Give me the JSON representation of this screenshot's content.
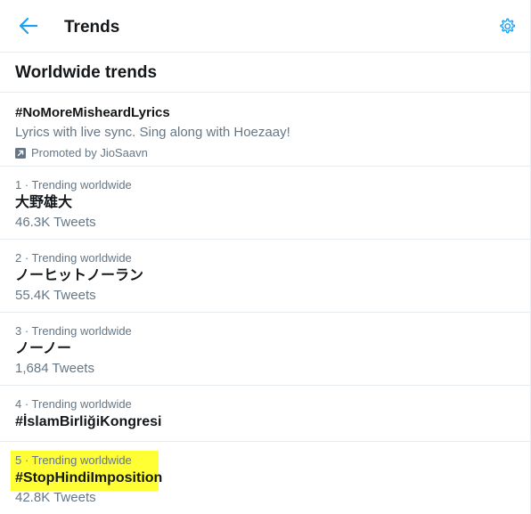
{
  "header": {
    "title": "Trends"
  },
  "section": {
    "heading": "Worldwide trends"
  },
  "promoted": {
    "tag": "#NoMoreMisheardLyrics",
    "description": "Lyrics with live sync. Sing along with Hoezaay!",
    "promoted_by": "Promoted by JioSaavn"
  },
  "trends": [
    {
      "meta": "1 · Trending worldwide",
      "name": "大野雄大",
      "count": "46.3K Tweets"
    },
    {
      "meta": "2 · Trending worldwide",
      "name": "ノーヒットノーラン",
      "count": "55.4K Tweets"
    },
    {
      "meta": "3 · Trending worldwide",
      "name": "ノーノー",
      "count": "1,684 Tweets"
    },
    {
      "meta": "4 · Trending worldwide",
      "name": "#İslamBirliğiKongresi"
    },
    {
      "meta": "5 · Trending worldwide",
      "name": "#StopHindiImposition",
      "count": "42.8K Tweets"
    }
  ],
  "colors": {
    "accent": "#1da1f2",
    "highlight": "#ffff33",
    "secondary_text": "#657786",
    "border": "#e6ecf0"
  },
  "icons": {
    "back": "back-arrow-icon",
    "settings": "gear-icon",
    "promoted": "promoted-icon"
  }
}
